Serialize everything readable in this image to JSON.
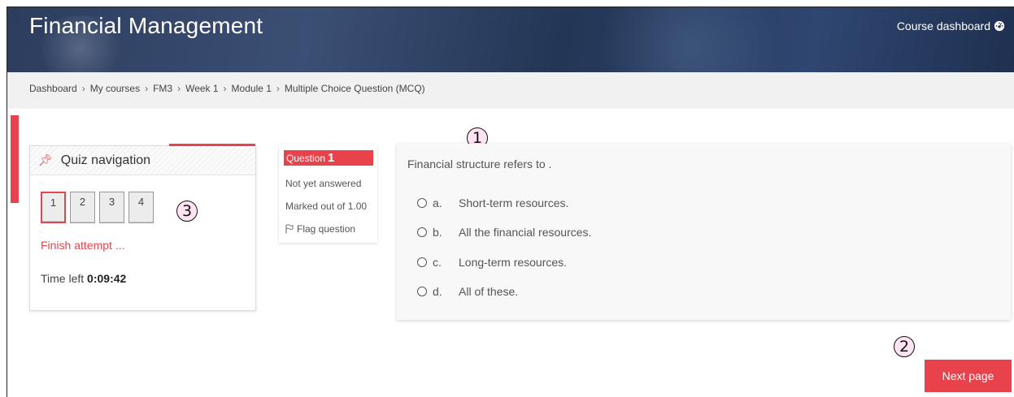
{
  "header": {
    "course_title": "Financial Management",
    "dashboard_link": "Course dashboard",
    "dashboard_icon": "dashboard-gauge-icon"
  },
  "breadcrumb": [
    "Dashboard",
    "My courses",
    "FM3",
    "Week 1",
    "Module 1",
    "Multiple Choice Question (MCQ)"
  ],
  "quiz_nav": {
    "title": "Quiz navigation",
    "pin_icon": "pin-icon",
    "questions": [
      "1",
      "2",
      "3",
      "4"
    ],
    "current_question": "1",
    "finish_label": "Finish attempt ...",
    "time_left_label": "Time left",
    "time_left_value": "0:09:42"
  },
  "question_info": {
    "label": "Question",
    "number": "1",
    "status": "Not yet answered",
    "marks": "Marked out of 1.00",
    "flag_label": "Flag question",
    "flag_icon": "flag-icon"
  },
  "question": {
    "text": "Financial structure refers to .",
    "answers": [
      {
        "letter": "a.",
        "text": "Short-term resources."
      },
      {
        "letter": "b.",
        "text": "All the financial resources."
      },
      {
        "letter": "c.",
        "text": "Long-term resources."
      },
      {
        "letter": "d.",
        "text": "All of these."
      }
    ]
  },
  "callouts": [
    "1",
    "2",
    "3"
  ],
  "next_button": "Next page",
  "colors": {
    "accent": "#e8434c",
    "banner": "#2c3d5e"
  }
}
